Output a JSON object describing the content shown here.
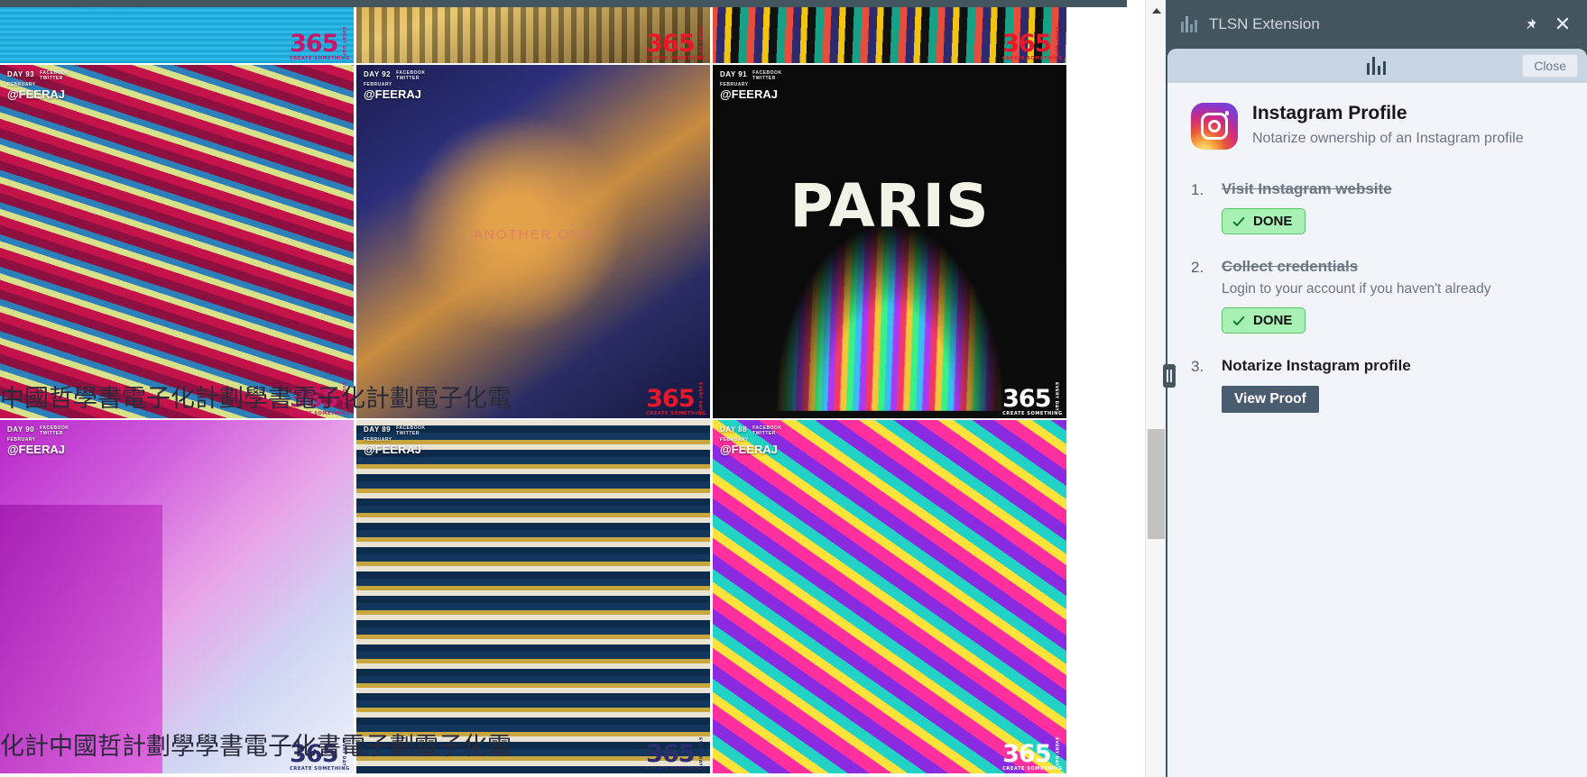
{
  "window": {
    "panel_title": "TLSN Extension",
    "pin_icon": "pin-icon",
    "close_icon": "close-icon"
  },
  "panel": {
    "logo_alt": "tlsn-logo",
    "close_label": "Close",
    "app": {
      "icon": "instagram-icon",
      "title": "Instagram Profile",
      "description": "Notarize ownership of an Instagram profile"
    },
    "steps": [
      {
        "number": "1.",
        "title": "Visit Instagram website",
        "subtitle": "",
        "completed": true,
        "button_label": "DONE",
        "button_kind": "done"
      },
      {
        "number": "2.",
        "title": "Collect credentials",
        "subtitle": "Login to your account if you haven't already",
        "completed": true,
        "button_label": "DONE",
        "button_kind": "done"
      },
      {
        "number": "3.",
        "title": "Notarize Instagram profile",
        "subtitle": "",
        "completed": false,
        "button_label": "View Proof",
        "button_kind": "action"
      }
    ]
  },
  "colors": {
    "panel_chrome": "#44555f",
    "card_bg": "#f1f4f8",
    "card_header": "#c7d5e3",
    "done_fill": "#a9f0b4",
    "done_border": "#5cc46f",
    "action_btn": "#4a5c70",
    "instagram_gradient_from": "#fdd36a",
    "instagram_gradient_to": "#5b4fe9"
  },
  "gallery": {
    "overlay_text_top": "中國哲學書電子化計劃學書電子化計劃電子化電",
    "overlay_text_bottom": "化計中國哲計劃學學書電子化書電子劃電子化電",
    "tiles": [
      {
        "id": "tile-1",
        "art": "art-a",
        "badge": "365",
        "badge_sub": "CREATE SOMETHING",
        "badge_vert": "EVERY DAY",
        "badge_color": "b-mag",
        "daytag": "",
        "day_meta": "",
        "handle": "",
        "word": "",
        "clip_top": true
      },
      {
        "id": "tile-2",
        "art": "art-b",
        "badge": "365",
        "badge_sub": "CREATE SOMETHING",
        "badge_vert": "EVERY DAY",
        "badge_color": "b-red",
        "daytag": "",
        "day_meta": "",
        "handle": "",
        "word": "",
        "clip_top": true
      },
      {
        "id": "tile-3",
        "art": "art-c",
        "badge": "365",
        "badge_sub": "CREATE SOMETHING",
        "badge_vert": "EVERY DAY",
        "badge_color": "b-red",
        "daytag": "",
        "day_meta": "",
        "handle": "",
        "word": "",
        "clip_top": true
      },
      {
        "id": "tile-4",
        "art": "art-d",
        "badge": "365",
        "badge_sub": "CREATE SOMETHING",
        "badge_vert": "EVERY DAY",
        "badge_color": "b-mag",
        "daytag": "DAY 93",
        "day_meta": "FEBRUARY",
        "handle": "@FEERAJ",
        "word": "",
        "clip_top": false
      },
      {
        "id": "tile-5",
        "art": "art-e",
        "badge": "365",
        "badge_sub": "CREATE SOMETHING",
        "badge_vert": "EVERY DAY",
        "badge_color": "b-red",
        "daytag": "DAY 92",
        "day_meta": "FEBRUARY",
        "handle": "@FEERAJ",
        "word": "ANOTHER ONE",
        "clip_top": false
      },
      {
        "id": "tile-6",
        "art": "art-f",
        "badge": "365",
        "badge_sub": "CREATE SOMETHING",
        "badge_vert": "EVERY DAY",
        "badge_color": "b-white",
        "daytag": "DAY 91",
        "day_meta": "FEBRUARY",
        "handle": "@FEERAJ",
        "word": "PARIS",
        "clip_top": false
      },
      {
        "id": "tile-7",
        "art": "art-g",
        "badge": "365",
        "badge_sub": "CREATE SOMETHING",
        "badge_vert": "EVERY DAY",
        "badge_color": "b-dark",
        "daytag": "DAY 90",
        "day_meta": "FEBRUARY",
        "handle": "@FEERAJ",
        "word": "",
        "clip_top": false
      },
      {
        "id": "tile-8",
        "art": "art-h",
        "badge": "365",
        "badge_sub": "CREATE SOMETHING",
        "badge_vert": "EVERY DAY",
        "badge_color": "b-dark",
        "daytag": "DAY 89",
        "day_meta": "FEBRUARY",
        "handle": "@FEERAJ",
        "word": "",
        "clip_top": false
      },
      {
        "id": "tile-9",
        "art": "art-i",
        "badge": "365",
        "badge_sub": "CREATE SOMETHING",
        "badge_vert": "EVERY DAY",
        "badge_color": "b-white",
        "daytag": "DAY 88",
        "day_meta": "FEBRUARY",
        "handle": "@FEERAJ",
        "word": "",
        "clip_top": false
      }
    ]
  },
  "scrollbar": {
    "up_arrow_icon": "scroll-up-arrow-icon",
    "thumb": "scroll-thumb"
  }
}
